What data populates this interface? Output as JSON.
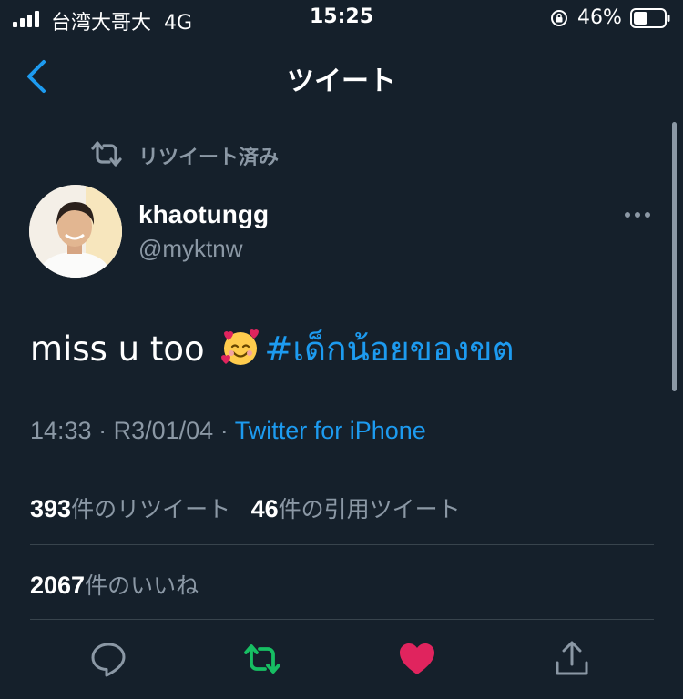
{
  "status_bar": {
    "carrier": "台湾大哥大",
    "network": "4G",
    "time": "15:25",
    "battery_percent": "46%",
    "battery_level": 0.46,
    "icons": [
      "signal-icon",
      "orientation-lock-icon",
      "battery-icon"
    ]
  },
  "header": {
    "back_icon": "chevron-left-icon",
    "title": "ツイート",
    "accent_color": "#1d9bf0"
  },
  "tweet": {
    "retweet_label": "リツイート済み",
    "author": {
      "name": "khaotungg",
      "handle": "@myktnw"
    },
    "text_plain": "miss u too ",
    "emoji": "smiling-face-with-hearts",
    "hashtag": "#เด็กน้อยของขต",
    "time": "14:33",
    "date": "R3/01/04",
    "separator": "·",
    "source": "Twitter for iPhone",
    "stats": {
      "retweets_count": "393",
      "retweets_label": "件のリツイート",
      "quotes_count": "46",
      "quotes_label": "件の引用ツイート",
      "likes_count": "2067",
      "likes_label": "件のいいね"
    },
    "actions": {
      "reply_icon": "reply-icon",
      "retweet_icon": "retweet-icon",
      "like_icon": "heart-icon",
      "share_icon": "share-icon",
      "retweet_color": "#17bf63",
      "like_color": "#e0245e"
    }
  }
}
